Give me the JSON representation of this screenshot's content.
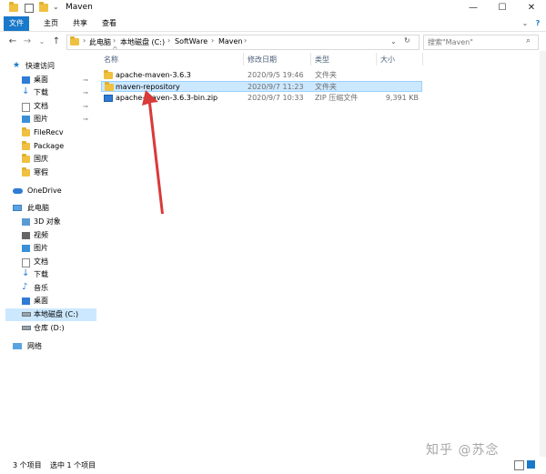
{
  "window": {
    "title": "Maven",
    "controls": {
      "minimize": "—",
      "maximize": "☐",
      "close": "✕"
    }
  },
  "ribbon": {
    "tabs": [
      "文件",
      "主页",
      "共享",
      "查看"
    ]
  },
  "address": {
    "back": "←",
    "forward": "→",
    "recent": "⌄",
    "up": "↑",
    "crumbs": [
      "此电脑",
      "本地磁盘 (C:)",
      "SoftWare",
      "Maven"
    ],
    "separator": "›",
    "refresh": "↻"
  },
  "search": {
    "placeholder": "搜索\"Maven\""
  },
  "sidebar": {
    "quick_access": "快速访问",
    "items": [
      {
        "label": "桌面",
        "pinned": true
      },
      {
        "label": "下载",
        "pinned": true
      },
      {
        "label": "文档",
        "pinned": true
      },
      {
        "label": "图片",
        "pinned": true
      },
      {
        "label": "FileRecv",
        "pinned": false
      },
      {
        "label": "Package",
        "pinned": false
      },
      {
        "label": "国庆",
        "pinned": false
      },
      {
        "label": "寒假",
        "pinned": false
      }
    ],
    "onedrive": "OneDrive",
    "this_pc": "此电脑",
    "pc_items": [
      "3D 对象",
      "视频",
      "图片",
      "文档",
      "下载",
      "音乐",
      "桌面",
      "本地磁盘 (C:)",
      "仓库 (D:)"
    ],
    "network": "网络",
    "pin_glyph": "📌"
  },
  "filelist": {
    "columns": {
      "name": "名称",
      "modified": "修改日期",
      "type": "类型",
      "size": "大小"
    },
    "sort_indicator": "^",
    "rows": [
      {
        "name": "apache-maven-3.6.3",
        "modified": "2020/9/5 19:46",
        "type": "文件夹",
        "size": "",
        "selected": false,
        "kind": "folder"
      },
      {
        "name": "maven-repository",
        "modified": "2020/9/7 11:23",
        "type": "文件夹",
        "size": "",
        "selected": true,
        "kind": "folder"
      },
      {
        "name": "apache-maven-3.6.3-bin.zip",
        "modified": "2020/9/7 10:33",
        "type": "ZIP 压缩文件",
        "size": "9,391 KB",
        "selected": false,
        "kind": "zip"
      }
    ]
  },
  "status": {
    "count": "3 个项目",
    "selected": "选中 1 个项目"
  },
  "watermark": "知乎 @苏念",
  "colors": {
    "accent": "#1979ca",
    "selection": "#cce8ff",
    "folder": "#f0c040",
    "arrow": "#d93a3a"
  }
}
